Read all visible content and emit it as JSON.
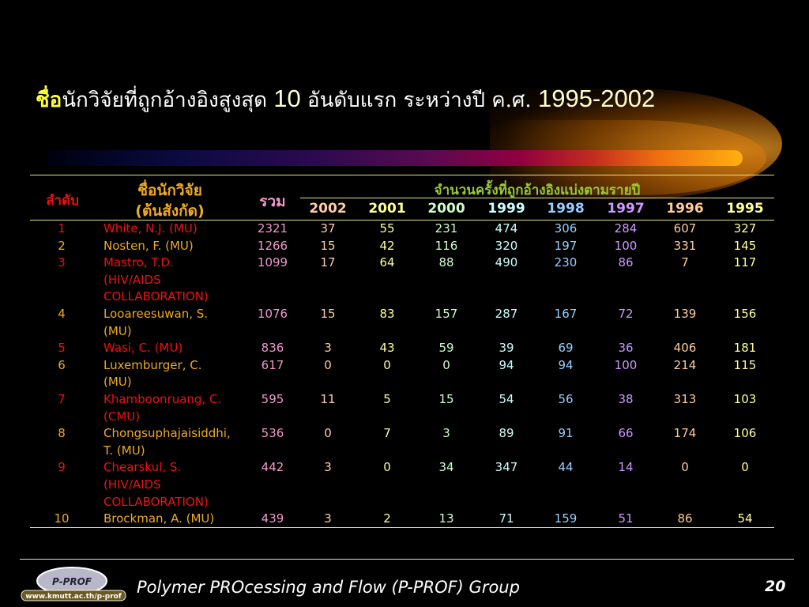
{
  "title": {
    "highlight": "ชื่อ",
    "part1": "นักวิจัยที่ถูกอ้างอิงสูงสุด ",
    "n": "10",
    "part2": " อันดับแรก ระหว่างปี ค.ศ. ",
    "years": "1995-2002"
  },
  "colors": {
    "rank_odd": "#ee1111",
    "rank_even": "#eeaa22",
    "total": "#ee99cc"
  },
  "header": {
    "rank": "ลำดับ",
    "name_line1": "ชื่อนักวิจัย",
    "name_line2": "(ต้นสังกัด)",
    "total": "รวม",
    "group": "จำนวนครั้งที่ถูกอ้างอิงแบ่งตามรายปี",
    "years": [
      {
        "label": "2002",
        "color": "#ffccaa"
      },
      {
        "label": "2001",
        "color": "#ffff99"
      },
      {
        "label": "2000",
        "color": "#ccffcc"
      },
      {
        "label": "1999",
        "color": "#ccffff"
      },
      {
        "label": "1998",
        "color": "#99ccff"
      },
      {
        "label": "1997",
        "color": "#cc99ff"
      },
      {
        "label": "1996",
        "color": "#ffcc99"
      },
      {
        "label": "1995",
        "color": "#ffff99"
      }
    ]
  },
  "rows": [
    {
      "rank": "1",
      "name": [
        "White, N.J.  (MU)"
      ],
      "total": "2321",
      "values": [
        "37",
        "55",
        "231",
        "474",
        "306",
        "284",
        "607",
        "327"
      ]
    },
    {
      "rank": "2",
      "name": [
        "Nosten, F.  (MU)"
      ],
      "total": "1266",
      "values": [
        "15",
        "42",
        "116",
        "320",
        "197",
        "100",
        "331",
        "145"
      ]
    },
    {
      "rank": "3",
      "name": [
        "Mastro, T.D.",
        "(HIV/AIDS",
        "COLLABORATION)"
      ],
      "total": "1099",
      "values": [
        "17",
        "64",
        "88",
        "490",
        "230",
        "86",
        "7",
        "117"
      ]
    },
    {
      "rank": "4",
      "name": [
        "Looareesuwan, S.",
        "(MU)"
      ],
      "total": "1076",
      "values": [
        "15",
        "83",
        "157",
        "287",
        "167",
        "72",
        "139",
        "156"
      ]
    },
    {
      "rank": "5",
      "name": [
        "Wasi, C.  (MU)"
      ],
      "total": "836",
      "values": [
        "3",
        "43",
        "59",
        "39",
        "69",
        "36",
        "406",
        "181"
      ]
    },
    {
      "rank": "6",
      "name": [
        "Luxemburger, C.",
        "(MU)"
      ],
      "total": "617",
      "values": [
        "0",
        "0",
        "0",
        "94",
        "94",
        "100",
        "214",
        "115"
      ]
    },
    {
      "rank": "7",
      "name": [
        "Khamboonruang, C.",
        "(CMU)"
      ],
      "total": "595",
      "values": [
        "11",
        "5",
        "15",
        "54",
        "56",
        "38",
        "313",
        "103"
      ]
    },
    {
      "rank": "8",
      "name": [
        "Chongsuphajaisiddhi,",
        "T. (MU)"
      ],
      "total": "536",
      "values": [
        "0",
        "7",
        "3",
        "89",
        "91",
        "66",
        "174",
        "106"
      ]
    },
    {
      "rank": "9",
      "name": [
        "Chearskul, S.",
        "(HIV/AIDS",
        "COLLABORATION)"
      ],
      "total": "442",
      "values": [
        "3",
        "0",
        "34",
        "347",
        "44",
        "14",
        "0",
        "0"
      ]
    },
    {
      "rank": "10",
      "name": [
        "Brockman, A. (MU)"
      ],
      "total": "439",
      "values": [
        "3",
        "2",
        "13",
        "71",
        "159",
        "51",
        "86",
        "54"
      ]
    }
  ],
  "footer": {
    "text": "Polymer PROcessing and Flow (P-PROF) Group",
    "page": "20",
    "logo_text": "P-PROF",
    "logo_url": "www.kmutt.ac.th/p-prof"
  }
}
